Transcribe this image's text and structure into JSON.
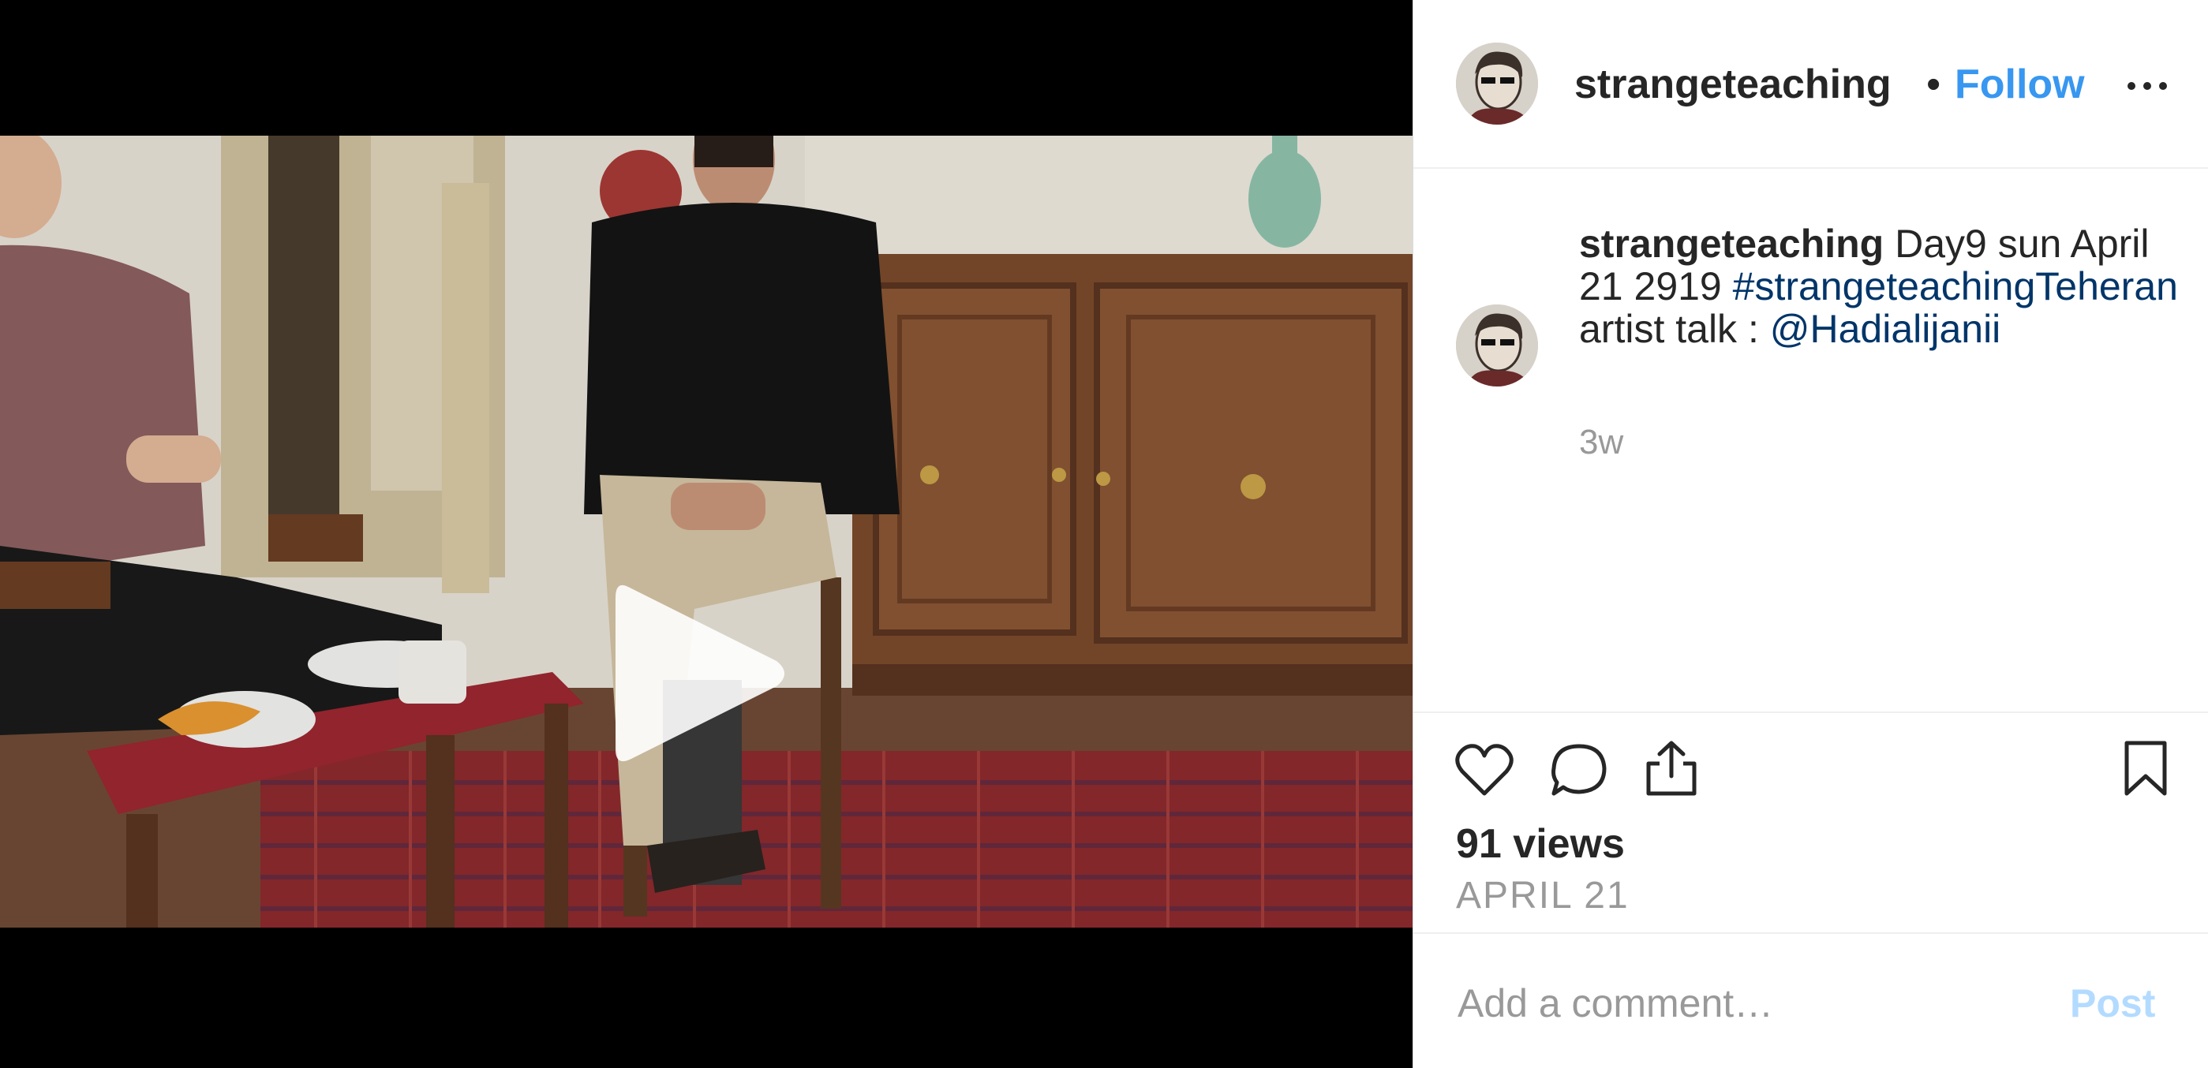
{
  "post": {
    "username": "strangeteaching",
    "separator": "•",
    "follow_label": "Follow",
    "more_icon": "more-horizontal-icon"
  },
  "caption": {
    "username": "strangeteaching",
    "text": " Day9 sun April 21 2919 ",
    "hashtag": "#strangeteachingTeheran",
    "line_text": " artist talk : ",
    "mention": "@Hadialijanii",
    "time_ago": "3w"
  },
  "actions": {
    "like_icon": "heart-icon",
    "comment_icon": "comment-icon",
    "share_icon": "share-icon",
    "save_icon": "bookmark-icon",
    "views": "91 views",
    "date": "APRIL 21"
  },
  "comment_form": {
    "placeholder": "Add a comment…",
    "post_label": "Post"
  },
  "video": {
    "play_icon": "play-icon"
  },
  "colors": {
    "link_blue": "#3897f0",
    "hashtag_blue": "#003569",
    "post_disabled": "#b3dbff",
    "muted": "#999999"
  }
}
